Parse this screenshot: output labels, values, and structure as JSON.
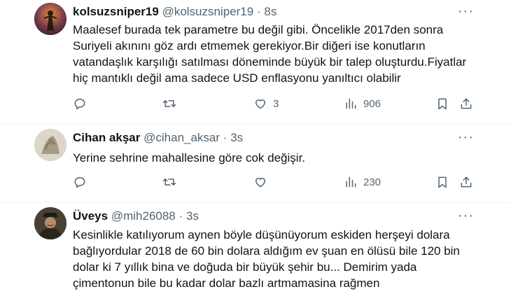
{
  "tweets": [
    {
      "name": "kolsuzsniper19",
      "handle": "@kolsuzsniper19",
      "time": "8s",
      "lines": [
        "Maalesef burada tek parametre bu değil gibi. Öncelikle 2017den sonra",
        "Suriyeli akınını göz ardı etmemek gerekiyor.Bir diğeri ise konutların",
        "vatandaşlık karşılığı satılması döneminde büyük bir talep oluşturdu.Fiyatlar",
        "hiç mantıklı değil ama sadece USD enflasyonu yanıltıcı olabilir"
      ],
      "likes": "3",
      "views": "906"
    },
    {
      "name": "Cihan akşar",
      "handle": "@cihan_aksar",
      "time": "3s",
      "lines": [
        "Yerine sehrine mahallesine göre cok değişir."
      ],
      "likes": "",
      "views": "230"
    },
    {
      "name": "Üveys",
      "handle": "@mih26088",
      "time": "3s",
      "lines": [
        "Kesinlikle katılıyorum aynen böyle düşünüyorum eskiden herşeyi dolara",
        "bağlıyordular 2018 de 60 bin dolara aldığım ev şuan en ölüsü bile 120 bin",
        "dolar ki 7 yıllık bina ve doğuda bir büyük şehir bu... Demirim yada",
        "çimentonun bile bu kadar dolar bazlı artmamasina rağmen"
      ]
    }
  ],
  "separator": "·",
  "icons": [
    "reply-icon",
    "retweet-icon",
    "like-icon",
    "views-icon",
    "bookmark-icon",
    "share-icon",
    "more-icon"
  ],
  "colors": {
    "text": "#0f1419",
    "secondary": "#536471",
    "divider": "#eff3f4"
  }
}
